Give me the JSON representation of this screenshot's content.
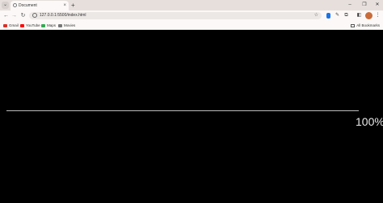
{
  "browser": {
    "tab": {
      "title": "Document",
      "close_glyph": "×"
    },
    "new_tab_glyph": "+",
    "window_controls": {
      "minimize": "–",
      "maximize": "❐",
      "close": "✕"
    },
    "nav": {
      "back": "←",
      "forward": "→",
      "reload": "↻"
    },
    "url": "127.0.0.1:5500/index.html",
    "bookmark_star": "☆",
    "bookmarks": [
      {
        "label": "Gmail",
        "icon": "gmail-icon",
        "color": "#d93025"
      },
      {
        "label": "YouTube",
        "icon": "youtube-icon",
        "color": "#ff0000"
      },
      {
        "label": "Maps",
        "icon": "maps-icon",
        "color": "#34a853"
      },
      {
        "label": "Movies",
        "icon": "movies-icon",
        "color": "#777777"
      }
    ],
    "all_bookmarks": "All Bookmarks"
  },
  "page": {
    "progress_percent": 100,
    "progress_label": "100%",
    "background": "#000000"
  }
}
